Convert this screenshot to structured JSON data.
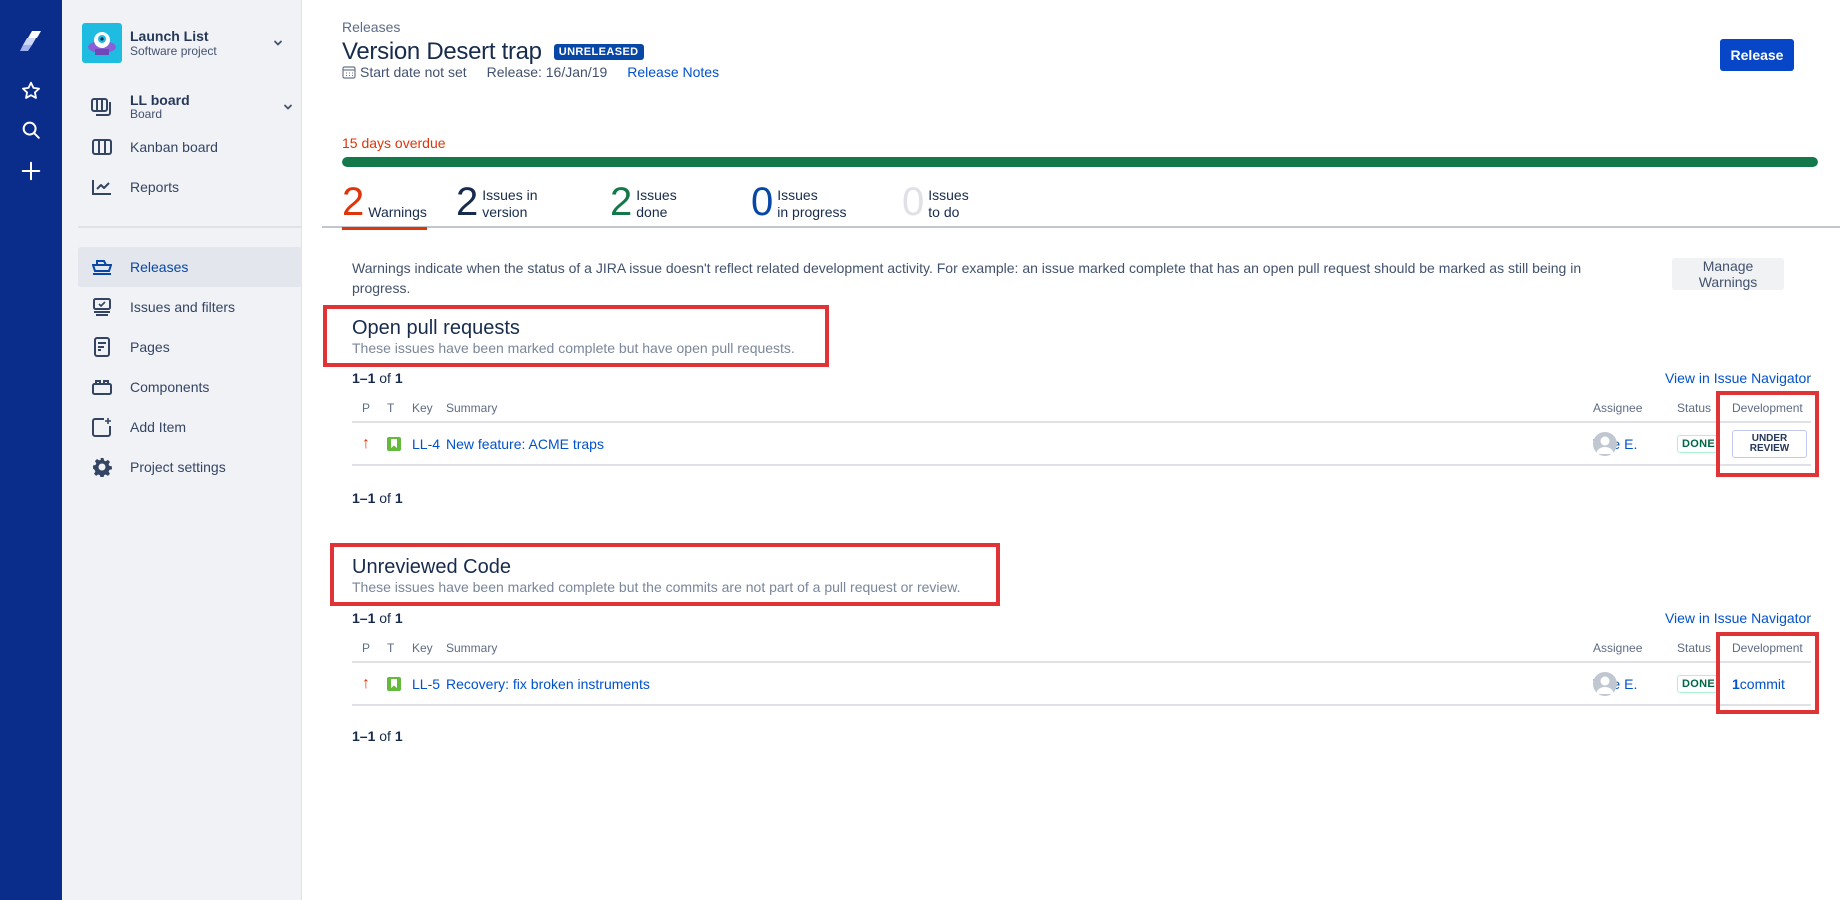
{
  "rail": {
    "icons": [
      "jira-logo-icon",
      "star-icon",
      "search-icon",
      "plus-icon"
    ]
  },
  "sidebar": {
    "project": {
      "name": "Launch List",
      "type": "Software project"
    },
    "board": {
      "name": "LL board",
      "type": "Board"
    },
    "items_top": [
      {
        "label": "Kanban board",
        "icon": "kanban-icon"
      },
      {
        "label": "Reports",
        "icon": "reports-icon"
      }
    ],
    "items": [
      {
        "label": "Releases",
        "icon": "ship-icon",
        "active": true
      },
      {
        "label": "Issues and filters",
        "icon": "issues-icon"
      },
      {
        "label": "Pages",
        "icon": "page-icon"
      },
      {
        "label": "Components",
        "icon": "components-icon"
      },
      {
        "label": "Add Item",
        "icon": "add-item-icon"
      },
      {
        "label": "Project settings",
        "icon": "gear-icon"
      }
    ]
  },
  "header": {
    "breadcrumb": "Releases",
    "title": "Version Desert trap",
    "status_lozenge": "UNRELEASED",
    "start_date": "Start date not set",
    "release_date": "Release: 16/Jan/19",
    "release_notes_link": "Release Notes",
    "release_button": "Release"
  },
  "progress": {
    "overdue_text": "15 days overdue",
    "done_fraction": 1.0,
    "colors": {
      "done": "#13784a",
      "overdue": "#de350b"
    }
  },
  "tabs": [
    {
      "count": "2",
      "label1": "",
      "label2": "Warnings",
      "color": "#de350b",
      "selected": true
    },
    {
      "count": "2",
      "label1": "Issues in",
      "label2": "version",
      "color": "#172b4d"
    },
    {
      "count": "2",
      "label1": "Issues",
      "label2": "done",
      "color": "#13784a"
    },
    {
      "count": "0",
      "label1": "Issues",
      "label2": "in progress",
      "color": "#0747a6"
    },
    {
      "count": "0",
      "label1": "Issues",
      "label2": "to do",
      "color": "#dfe1e6"
    }
  ],
  "warnings": {
    "description": "Warnings indicate when the status of a JIRA issue doesn't reflect related development activity. For example: an issue marked complete that has an open pull request should be marked as still being in progress.",
    "manage_button": "Manage Warnings"
  },
  "table_headers": {
    "p": "P",
    "t": "T",
    "key": "Key",
    "summary": "Summary",
    "assignee": "Assignee",
    "status": "Status",
    "development": "Development"
  },
  "sections": [
    {
      "title": "Open pull requests",
      "subtitle": "These issues have been marked complete but have open pull requests.",
      "count_range": "1–1",
      "count_of": "of",
      "count_total": "1",
      "navigator_link": "View in Issue Navigator",
      "rows": [
        {
          "priority": "↑",
          "key": "LL-4",
          "summary": "New feature: ACME traps",
          "assignee": "Wile E.",
          "status": "DONE",
          "development": "UNDER REVIEW"
        }
      ]
    },
    {
      "title": "Unreviewed Code",
      "subtitle": "These issues have been marked complete but the commits are not part of a pull request or review.",
      "count_range": "1–1",
      "count_of": "of",
      "count_total": "1",
      "navigator_link": "View in Issue Navigator",
      "rows": [
        {
          "priority": "↑",
          "key": "LL-5",
          "summary": "Recovery: fix broken instruments",
          "assignee": "Wile E.",
          "status": "DONE",
          "development_count": "1",
          "development_label": "commit"
        }
      ]
    }
  ]
}
